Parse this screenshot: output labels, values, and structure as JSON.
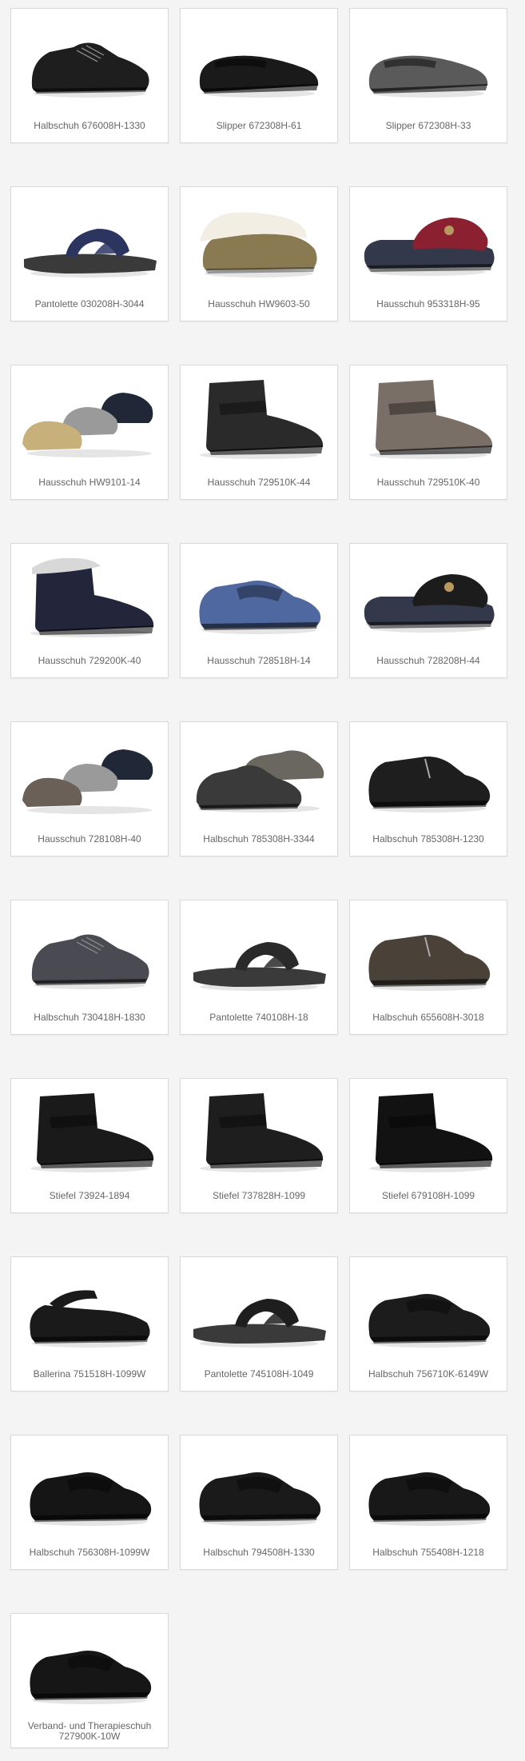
{
  "products": [
    {
      "label": "Halbschuh 676008H-1330",
      "icon": "lace-shoe-icon",
      "color": "#1e1e1e"
    },
    {
      "label": "Slipper 672308H-61",
      "icon": "slipper-shoe-icon",
      "color": "#1a1a1a"
    },
    {
      "label": "Slipper 672308H-33",
      "icon": "slipper-shoe-icon",
      "color": "#5a5a5a"
    },
    {
      "label": "Pantolette 030208H-3044",
      "icon": "sandal-icon",
      "color": "#2b3560"
    },
    {
      "label": "Hausschuh HW9603-50",
      "icon": "fur-slipper-icon",
      "color": "#8a7a52"
    },
    {
      "label": "Hausschuh 953318H-95",
      "icon": "house-slipper-icon",
      "color": "#8a2030"
    },
    {
      "label": "Hausschuh HW9101-14",
      "icon": "house-slipper-group-icon",
      "color": "#c8b07a"
    },
    {
      "label": "Hausschuh 729510K-44",
      "icon": "ankle-boot-icon",
      "color": "#2a2a2a"
    },
    {
      "label": "Hausschuh 729510K-40",
      "icon": "ankle-boot-icon",
      "color": "#7a6f66"
    },
    {
      "label": "Hausschuh 729200K-40",
      "icon": "fur-ankle-boot-icon",
      "color": "#23263a"
    },
    {
      "label": "Hausschuh 728518H-14",
      "icon": "velcro-shoe-icon",
      "color": "#5068a0"
    },
    {
      "label": "Hausschuh 728208H-44",
      "icon": "house-slipper-icon",
      "color": "#1c1c1c"
    },
    {
      "label": "Hausschuh 728108H-40",
      "icon": "house-slipper-group-icon",
      "color": "#6a6058"
    },
    {
      "label": "Halbschuh 785308H-3344",
      "icon": "lace-shoe-group-icon",
      "color": "#3a3a3a"
    },
    {
      "label": "Halbschuh 785308H-1230",
      "icon": "zip-shoe-icon",
      "color": "#1e1e1e"
    },
    {
      "label": "Halbschuh 730418H-1830",
      "icon": "lace-shoe-icon",
      "color": "#4a4a52"
    },
    {
      "label": "Pantolette 740108H-18",
      "icon": "sandal-icon",
      "color": "#2a2a2a"
    },
    {
      "label": "Halbschuh 655608H-3018",
      "icon": "zip-shoe-icon",
      "color": "#4a4238"
    },
    {
      "label": "Stiefel 73924-1894",
      "icon": "ankle-boot-icon",
      "color": "#1a1a1a"
    },
    {
      "label": "Stiefel 737828H-1099",
      "icon": "ankle-boot-icon",
      "color": "#1e1e1e"
    },
    {
      "label": "Stiefel 679108H-1099",
      "icon": "ankle-boot-icon",
      "color": "#121212"
    },
    {
      "label": "Ballerina 751518H-1099W",
      "icon": "mary-jane-icon",
      "color": "#1a1a1a"
    },
    {
      "label": "Pantolette 745108H-1049",
      "icon": "sandal-icon",
      "color": "#1e1e1e"
    },
    {
      "label": "Halbschuh 756710K-6149W",
      "icon": "velcro-shoe-icon",
      "color": "#1c1c1c"
    },
    {
      "label": "Halbschuh 756308H-1099W",
      "icon": "velcro-shoe-icon",
      "color": "#151515"
    },
    {
      "label": "Halbschuh 794508H-1330",
      "icon": "velcro-shoe-icon",
      "color": "#1a1a1a"
    },
    {
      "label": "Halbschuh 755408H-1218",
      "icon": "velcro-shoe-icon",
      "color": "#181818"
    },
    {
      "label": "Verband- und Therapieschuh 727900K-10W",
      "icon": "velcro-shoe-icon",
      "color": "#161616"
    }
  ]
}
